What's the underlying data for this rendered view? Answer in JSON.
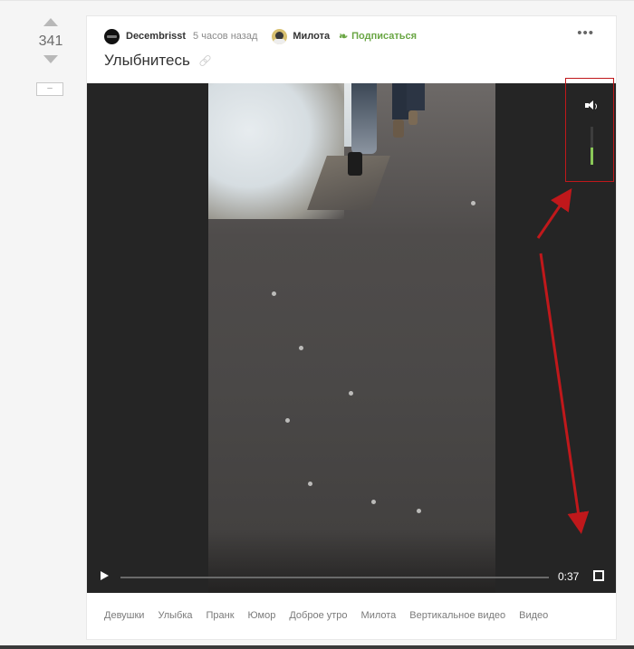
{
  "rating": {
    "score": "341",
    "collapse_label": "–"
  },
  "story": {
    "author": "Decembrisst",
    "time": "5 часов назад",
    "community": "Милота",
    "subscribe_label": "Подписаться",
    "more_label": "•••",
    "title": "Улыбнитесь"
  },
  "player": {
    "duration": "0:37",
    "progress_fraction": 0,
    "volume_fraction": 0.45,
    "icons": [
      "volume-icon",
      "play-icon",
      "fullscreen-icon"
    ]
  },
  "tags": [
    "Девушки",
    "Улыбка",
    "Пранк",
    "Юмор",
    "Доброе утро",
    "Милота",
    "Вертикальное видео",
    "Видео"
  ],
  "colors": {
    "accent_green": "#6aa644",
    "annotation_red": "#c0181b",
    "volume_fill": "#8ac858"
  }
}
